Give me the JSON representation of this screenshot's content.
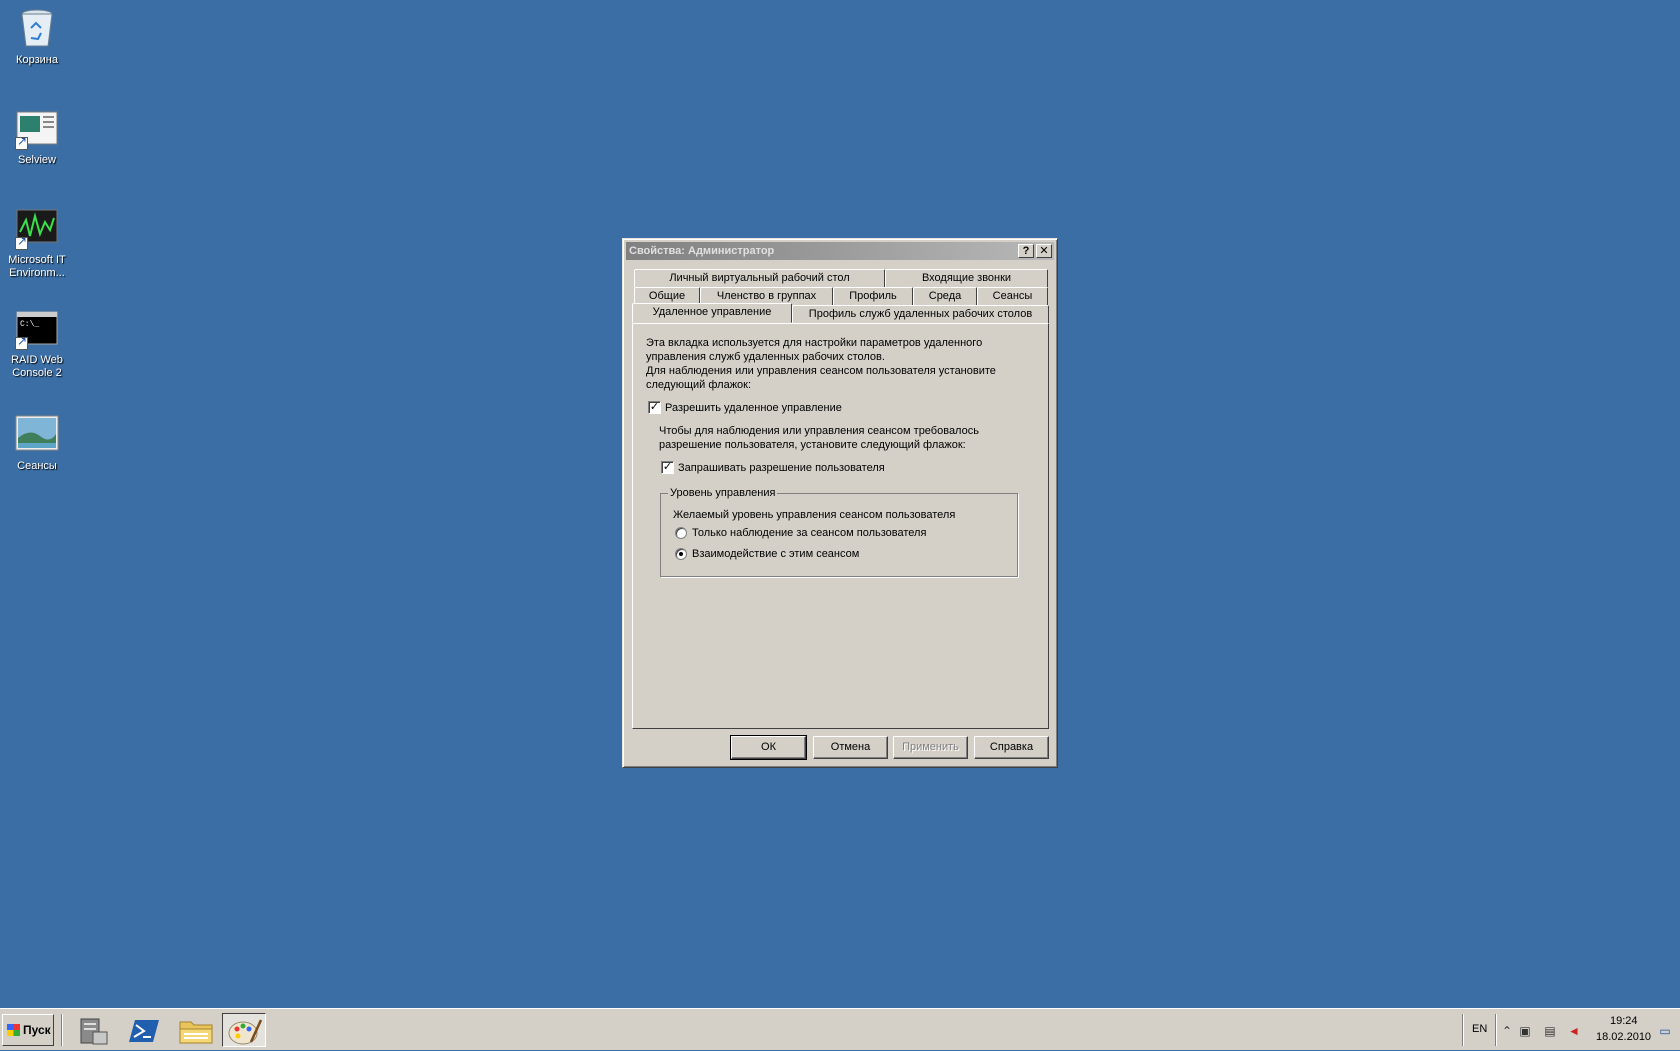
{
  "desktop": {
    "icons": [
      {
        "label": "Корзина",
        "icon": "recycle-bin-icon"
      },
      {
        "label": "Selview",
        "icon": "selview-icon"
      },
      {
        "label": "Microsoft IT Environm...",
        "icon": "monitor-graph-icon"
      },
      {
        "label": "RAID Web Console 2",
        "icon": "console-icon"
      },
      {
        "label": "Сеансы",
        "icon": "landscape-icon"
      }
    ]
  },
  "dialog": {
    "title": "Свойства: Администратор",
    "help_label": "?",
    "close_label": "✕",
    "tabs_row1": [
      "Личный виртуальный рабочий стол",
      "Входящие звонки"
    ],
    "tabs_row2": [
      "Общие",
      "Членство в группах",
      "Профиль",
      "Среда",
      "Сеансы"
    ],
    "tabs_row3": [
      "Удаленное управление",
      "Профиль служб удаленных рабочих столов"
    ],
    "active_tab": "Удаленное управление",
    "description_lines": [
      "Эта вкладка используется для настройки параметров удаленного",
      "управления служб удаленных рабочих столов.",
      "Для наблюдения или управления сеансом пользователя установите",
      "следующий флажок:"
    ],
    "enable_remote_control": {
      "label": "Разрешить удаленное управление",
      "checked": true
    },
    "permission_hint_lines": [
      "Чтобы для наблюдения или управления сеансом требовалось",
      "разрешение пользователя, установите следующий флажок:"
    ],
    "require_permission": {
      "label": "Запрашивать разрешение пользователя",
      "checked": true
    },
    "control_level": {
      "legend": "Уровень управления",
      "prompt": "Желаемый уровень управления сеансом пользователя",
      "options": [
        {
          "label": "Только наблюдение за сеансом пользователя",
          "selected": false
        },
        {
          "label": "Взаимодействие с этим сеансом",
          "selected": true
        }
      ]
    },
    "buttons": {
      "ok": "ОК",
      "cancel": "Отмена",
      "apply": "Применить",
      "help": "Справка"
    }
  },
  "taskbar": {
    "start_label": "Пуск",
    "quick_launch": [
      "server-manager-icon",
      "powershell-icon",
      "explorer-folder-icon",
      "paint-icon"
    ],
    "language": "EN",
    "time": "19:24",
    "date": "18.02.2010"
  }
}
